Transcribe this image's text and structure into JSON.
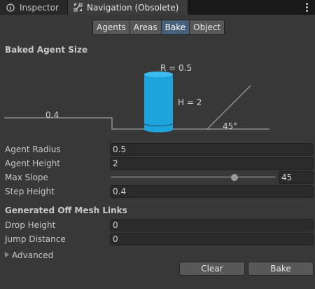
{
  "tabs": [
    {
      "label": "Inspector",
      "icon": "info-icon"
    },
    {
      "label": "Navigation (Obsolete)",
      "icon": "navigation-icon"
    }
  ],
  "segments": [
    "Agents",
    "Areas",
    "Bake",
    "Object"
  ],
  "selected_segment": "Bake",
  "baked_agent_size": {
    "title": "Baked Agent Size",
    "diagram": {
      "radius_label": "R = 0.5",
      "height_label": "H = 2",
      "step_label": "0.4",
      "slope_label": "45°"
    }
  },
  "properties": {
    "agent_radius": {
      "label": "Agent Radius",
      "value": "0.5"
    },
    "agent_height": {
      "label": "Agent Height",
      "value": "2"
    },
    "max_slope": {
      "label": "Max Slope",
      "value": "45",
      "slider_fraction": 0.75
    },
    "step_height": {
      "label": "Step Height",
      "value": "0.4"
    }
  },
  "off_mesh": {
    "title": "Generated Off Mesh Links",
    "drop_height": {
      "label": "Drop Height",
      "value": "0"
    },
    "jump_distance": {
      "label": "Jump Distance",
      "value": "0"
    }
  },
  "advanced_label": "Advanced",
  "buttons": {
    "clear": "Clear",
    "bake": "Bake"
  },
  "colors": {
    "cylinder": "#1ea4dc",
    "selected_segment": "#46607c"
  }
}
